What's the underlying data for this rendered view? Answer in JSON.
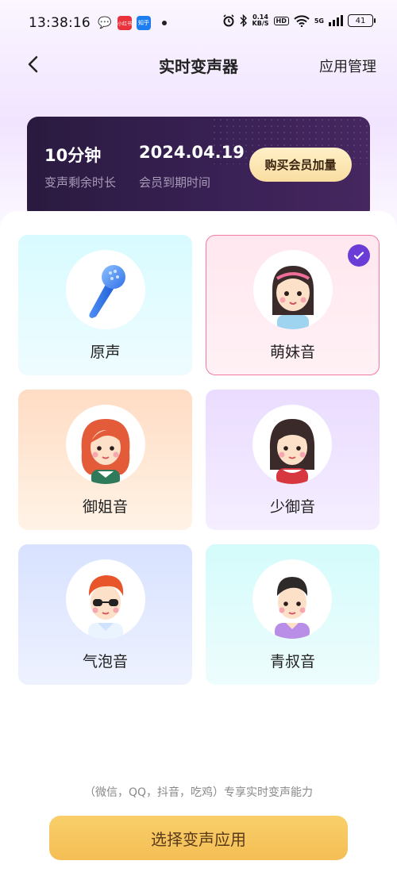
{
  "status_bar": {
    "time": "13:38:16",
    "speed_value": "0.14",
    "speed_unit": "KB/S",
    "hd": "HD",
    "network": "5G",
    "battery": "41",
    "app_icon_1": "💬",
    "app_icon_2": "小红书",
    "app_icon_3": "知乎"
  },
  "header": {
    "title": "实时变声器",
    "manage_label": "应用管理"
  },
  "membership": {
    "remaining_value": "10分钟",
    "remaining_label": "变声剩余时长",
    "expire_value": "2024.04.19",
    "expire_label": "会员到期时间",
    "buy_label": "购买会员加量"
  },
  "voices": [
    {
      "label": "原声",
      "icon": "microphone-icon",
      "selected": false
    },
    {
      "label": "萌妹音",
      "icon": "cute-girl-avatar",
      "selected": true
    },
    {
      "label": "御姐音",
      "icon": "mature-woman-avatar",
      "selected": false
    },
    {
      "label": "少御音",
      "icon": "young-woman-avatar",
      "selected": false
    },
    {
      "label": "气泡音",
      "icon": "cool-boy-avatar",
      "selected": false
    },
    {
      "label": "青叔音",
      "icon": "young-man-avatar",
      "selected": false
    }
  ],
  "footer": {
    "hint": "（微信，QQ，抖音，吃鸡）专享实时变声能力",
    "apply_label": "选择变声应用"
  },
  "colors": {
    "accent_purple": "#6a3ed6",
    "apply_button": "#f4be55",
    "card_dark": "#2a1a3f"
  }
}
